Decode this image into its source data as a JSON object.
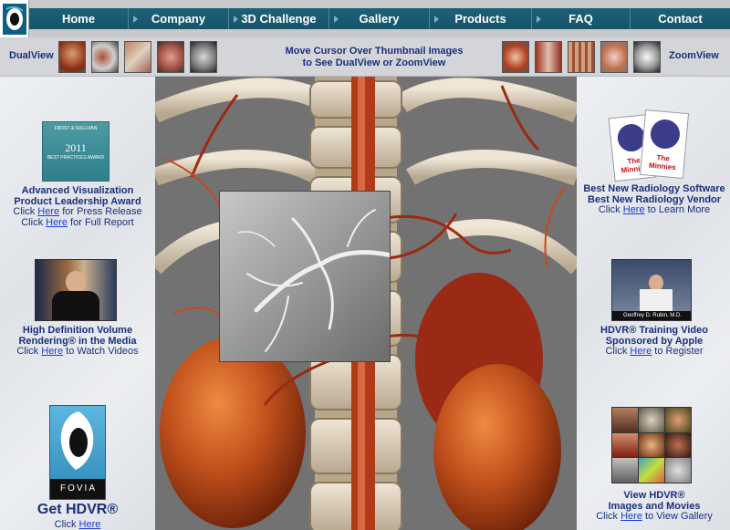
{
  "nav": {
    "items": [
      {
        "label": "Home"
      },
      {
        "label": "Company"
      },
      {
        "label": "3D Challenge"
      },
      {
        "label": "Gallery"
      },
      {
        "label": "Products"
      },
      {
        "label": "FAQ"
      },
      {
        "label": "Contact"
      }
    ]
  },
  "strip": {
    "left_label": "DualView",
    "right_label": "ZoomView",
    "instruction_line1": "Move Cursor Over Thumbnail Images",
    "instruction_line2": "to See DualView or ZoomView"
  },
  "left": {
    "award": {
      "line1": "Advanced Visualization",
      "line2": "Product Leadership Award",
      "click1": "Click",
      "here1": "Here",
      "rest1": "for Press Release",
      "click2": "Click",
      "here2": "Here",
      "rest2": "for Full Report",
      "badge_top": "FROST & SULLIVAN",
      "badge_year": "2011",
      "badge_text": "BEST PRACTICES AWARD"
    },
    "media": {
      "line1": "High Definition Volume",
      "line2": "Rendering® in the Media",
      "click": "Click",
      "here": "Here",
      "rest": "to Watch Videos"
    },
    "hdvr": {
      "logo_text": "FOVIA",
      "title": "Get HDVR®",
      "click": "Click",
      "here": "Here"
    }
  },
  "right": {
    "minnies": {
      "line1": "Best New Radiology Software",
      "line2": "Best New Radiology Vendor",
      "click": "Click",
      "here": "Here",
      "rest": "to Learn More",
      "card_text": "The Minnies"
    },
    "training": {
      "line1": "HDVR® Training Video",
      "line2": "Sponsored by Apple",
      "click": "Click",
      "here": "Here",
      "rest": "to Register",
      "caption": "Geoffrey D. Rubin, M.D."
    },
    "gallery": {
      "line1": "View HDVR®",
      "line2": "Images and Movies",
      "click": "Click",
      "here": "Here",
      "rest": "to View Gallery"
    }
  },
  "colors": {
    "nav_bg": "#175467",
    "link": "#1a3fd0",
    "text": "#1b2f7c"
  }
}
